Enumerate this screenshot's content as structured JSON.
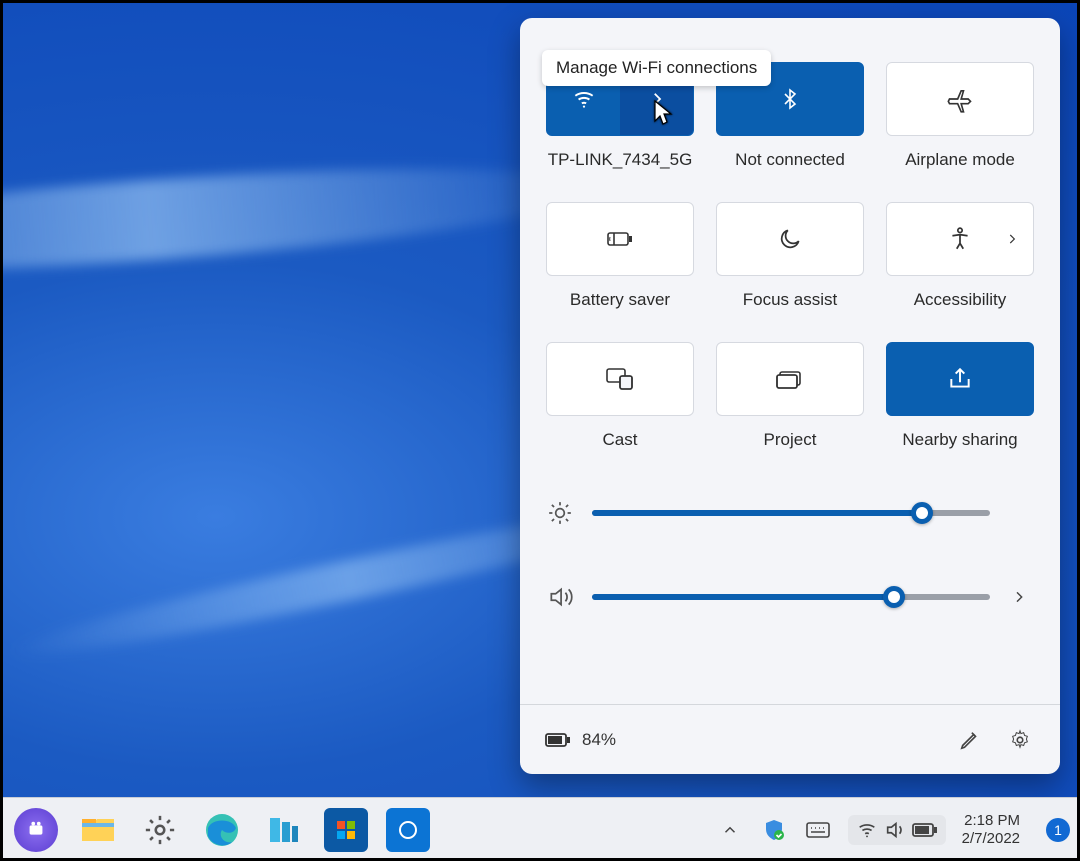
{
  "tooltip": "Manage Wi-Fi connections",
  "tiles": {
    "wifi": {
      "label": "TP-LINK_7434_5G"
    },
    "bluetooth": {
      "label": "Not connected"
    },
    "airplane": {
      "label": "Airplane mode"
    },
    "battery_saver": {
      "label": "Battery saver"
    },
    "focus_assist": {
      "label": "Focus assist"
    },
    "accessibility": {
      "label": "Accessibility"
    },
    "cast": {
      "label": "Cast"
    },
    "project": {
      "label": "Project"
    },
    "nearby": {
      "label": "Nearby sharing"
    }
  },
  "sliders": {
    "brightness": {
      "percent": 83
    },
    "volume": {
      "percent": 76
    }
  },
  "panel_footer": {
    "battery_text": "84%"
  },
  "accent_color": "#0a5fb0",
  "taskbar": {
    "time": "2:18 PM",
    "date": "2/7/2022",
    "notification_count": "1"
  }
}
